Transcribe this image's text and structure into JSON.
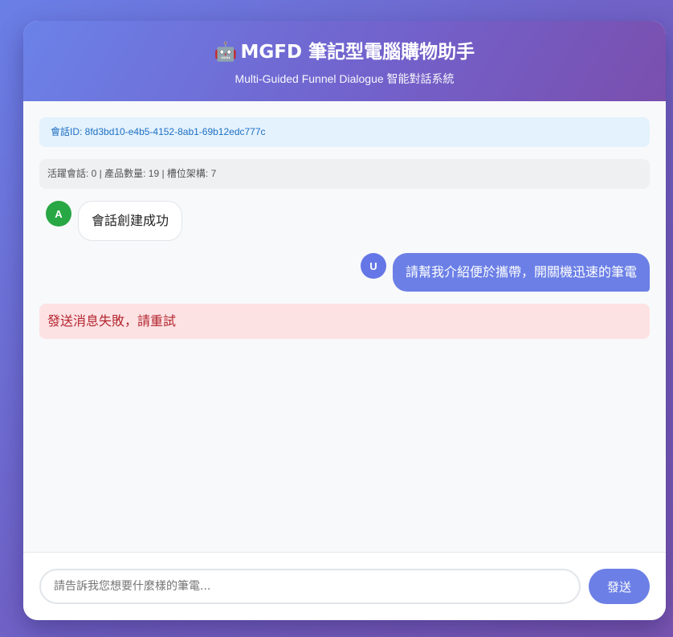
{
  "header": {
    "icon": "robot-icon",
    "icon_glyph": "🤖",
    "title": "MGFD 筆記型電腦購物助手",
    "subtitle": "Multi-Guided Funnel Dialogue 智能對話系統"
  },
  "session": {
    "id_text": "會話ID: 8fd3bd10-e4b5-4152-8ab1-69b12edc777c"
  },
  "stats": {
    "text": "活躍會話: 0 | 產品數量: 19 | 槽位架構: 7"
  },
  "messages": [
    {
      "role": "assistant",
      "avatar": "A",
      "text": "會話創建成功"
    },
    {
      "role": "user",
      "avatar": "U",
      "text": "請幫我介紹便於攜帶，開關機迅速的筆電"
    }
  ],
  "error": {
    "text": "發送消息失敗，請重試"
  },
  "composer": {
    "value": "",
    "placeholder": "請告訴我您想要什麼樣的筆電...",
    "send_label": "發送"
  },
  "colors": {
    "accent": "#6b7fe6",
    "bot_avatar": "#28a745",
    "error_bg": "#fde2e4",
    "error_text": "#b3262e",
    "session_bg": "#e3f2fd"
  }
}
